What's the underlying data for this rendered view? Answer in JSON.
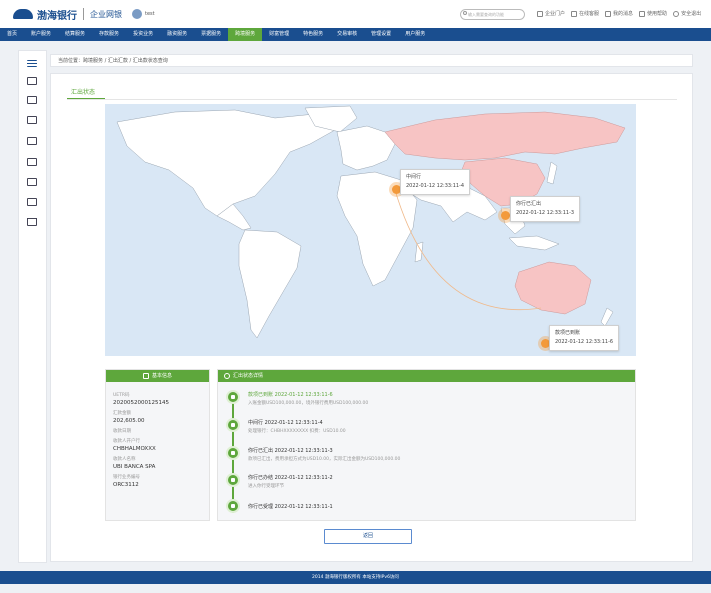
{
  "header": {
    "bank_name": "渤海银行",
    "portal": "企业网银",
    "user_name": "test",
    "search_placeholder": "输入需要查询的功能",
    "links": [
      "企业门户",
      "在线客服",
      "我的消息",
      "使用帮助",
      "安全退出"
    ]
  },
  "nav": {
    "items": [
      "首页",
      "账户服务",
      "结算服务",
      "存款服务",
      "投资业务",
      "融资服务",
      "票据服务",
      "跨境服务",
      "财富管理",
      "特色服务",
      "交易审核",
      "管理设置",
      "用户服务"
    ],
    "active_index": 7
  },
  "breadcrumb": "当前位置：跨境服务 / 汇出汇款 / 汇出款状态查询",
  "tab_label": "汇出状态",
  "map": {
    "popups": [
      {
        "line1": "中间行",
        "line2": "2022-01-12 12:33:11-4"
      },
      {
        "line1": "你行已汇出",
        "line2": "2022-01-12 12:33:11-3"
      },
      {
        "line1": "款项已到账",
        "line2": "2022-01-12 12:33:11-6"
      }
    ]
  },
  "info": {
    "title": "基本信息",
    "fields": [
      {
        "label": "UETR码",
        "value": "2020052000125145"
      },
      {
        "label": "汇款金额",
        "value": "202,605.00"
      },
      {
        "label": "收款日期",
        "value": ""
      },
      {
        "label": "收款人开户行",
        "value": "CHBHALMOXXX"
      },
      {
        "label": "收款人名称",
        "value": "UBI BANCA SPA"
      },
      {
        "label": "银行业务编号",
        "value": "ORC3112"
      }
    ]
  },
  "timeline": {
    "title": "汇出状态详情",
    "steps": [
      {
        "title": "款项已到账  2022-01-12 12:33:11-6",
        "desc": "入账金额USD100,000.00，境外银行费用USD100,000.00"
      },
      {
        "title": "中间行  2022-01-12 12:33:11-4",
        "desc": "处理银行：CHBHXXXXXXXX 扣费：USD10.00"
      },
      {
        "title": "你行已汇出  2022-01-12 12:33:11-3",
        "desc": "款项已汇出，费用承担方式为USD10.00，实际汇出金额为USD100,000.00"
      },
      {
        "title": "你行已办结  2022-01-12 12:33:11-2",
        "desc": "进入你行受理环节"
      },
      {
        "title": "你行已受理  2022-01-12 12:33:11-1",
        "desc": ""
      }
    ]
  },
  "back_button": "返回",
  "footer": "2014 渤海银行版权所有  本站支持IPv6访问",
  "colors": {
    "navy": "#1a4e8f",
    "green": "#5ea73c",
    "orange": "#f39a3b",
    "pink": "#f7c4c4"
  }
}
